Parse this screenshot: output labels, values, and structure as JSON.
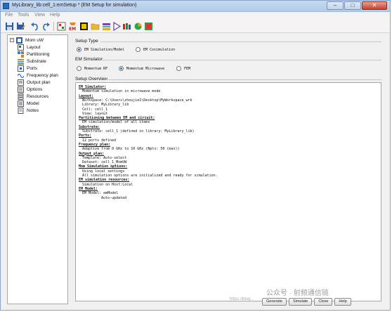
{
  "window": {
    "title": "MyLibrary_lib:cell_1:emSetup * (EM Setup for simulation)"
  },
  "window_controls": {
    "minimize": "–",
    "maximize": "□",
    "close": "✕"
  },
  "menu": [
    "File",
    "Tools",
    "View",
    "Help"
  ],
  "toolbar_icons": [
    "save-icon",
    "save-as-icon",
    "undo-icon",
    "redo-icon",
    "layout-view-icon",
    "em-simulate-icon",
    "generate-component-icon",
    "folder-icon",
    "stack-icon",
    "play-icon",
    "port-icon",
    "data-display-icon",
    "variables-icon",
    "tuning-icon"
  ],
  "tree": {
    "root": "Mom uW",
    "items": [
      "Layout",
      "Partitioning",
      "Substrate",
      "Ports",
      "Frequency plan",
      "Output plan",
      "Options",
      "Resources",
      "Model",
      "Notes"
    ]
  },
  "setup_type": {
    "title": "Setup Type",
    "options": [
      "EM Simulation/Model",
      "EM Cosimulation"
    ],
    "selected": 0
  },
  "em_simulator": {
    "title": "EM Simulator",
    "options": [
      "Momentum RF",
      "Momentum Microwave",
      "FEM"
    ],
    "selected": 1
  },
  "overview": {
    "title": "Setup Overview",
    "lines": [
      {
        "kind": "head",
        "text": "EM Simulator:"
      },
      {
        "kind": "body",
        "text": "Momentum simulation in microwave mode"
      },
      {
        "kind": "head",
        "text": "Layout:"
      },
      {
        "kind": "body",
        "text": "Workspace: C:\\Users\\zhoujie1\\Desktop\\MyWorkspace_wrk"
      },
      {
        "kind": "body",
        "text": "Library: MyLibrary_lib"
      },
      {
        "kind": "body",
        "text": "Cell: cell_1"
      },
      {
        "kind": "body",
        "text": "View: layout"
      },
      {
        "kind": "head",
        "text": "Partitioning between EM and circuit:"
      },
      {
        "kind": "body",
        "text": "EM simulation/model of all items"
      },
      {
        "kind": "head",
        "text": "Substrate:"
      },
      {
        "kind": "body",
        "text": "Substrate: cell_1 (defined in library: MyLibrary_lib)"
      },
      {
        "kind": "head",
        "text": "Ports:"
      },
      {
        "kind": "body",
        "text": "12 ports defined"
      },
      {
        "kind": "head",
        "text": "Frequency plan:"
      },
      {
        "kind": "body",
        "text": "Adaptive from 0 GHz to 10 GHz (Npts: 50 (max))"
      },
      {
        "kind": "head",
        "text": "Output plan:"
      },
      {
        "kind": "body",
        "text": "Template: Auto-select"
      },
      {
        "kind": "body",
        "text": "Dataset: cell_1_MomUW"
      },
      {
        "kind": "head",
        "text": "Mom Simulation options:"
      },
      {
        "kind": "body",
        "text": "Using local settings"
      },
      {
        "kind": "body",
        "text": "All simulation options are initialized and ready for simulation."
      },
      {
        "kind": "head",
        "text": "EM simulation resources:"
      },
      {
        "kind": "body",
        "text": "Simulation on Host:Local"
      },
      {
        "kind": "head",
        "text": "EM Model:"
      },
      {
        "kind": "body",
        "text": "EM Model: emModel"
      },
      {
        "kind": "body2",
        "text": "Auto-updated"
      }
    ]
  },
  "buttons": [
    "Generate",
    "Simulate",
    "Close",
    "Help"
  ],
  "watermark": "公众号 · 射频通信链",
  "watermark_small": "https://blog..."
}
